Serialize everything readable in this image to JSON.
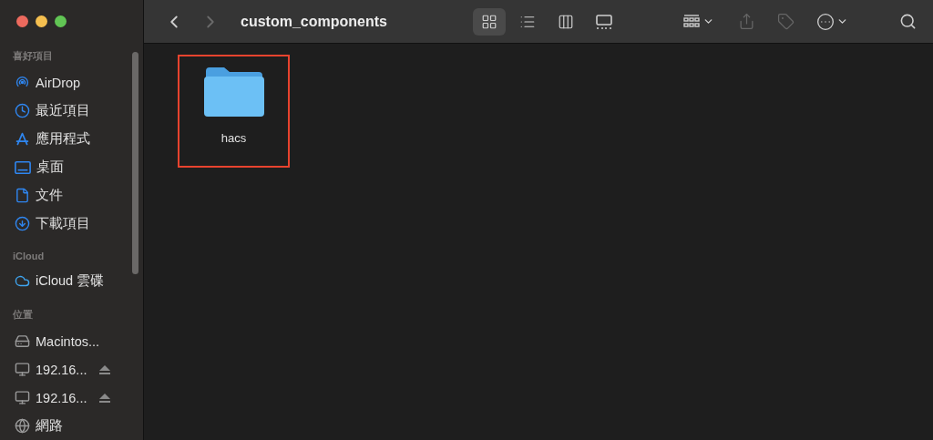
{
  "toolbar": {
    "title": "custom_components",
    "nav": [
      {
        "kind": "back",
        "disabled": false
      },
      {
        "kind": "forward",
        "disabled": true
      }
    ],
    "views": [
      {
        "kind": "icons",
        "selected": true
      },
      {
        "kind": "list",
        "selected": false
      },
      {
        "kind": "columns",
        "selected": false
      },
      {
        "kind": "gallery",
        "selected": false
      }
    ],
    "actions": [
      {
        "kind": "group",
        "disabled": false
      },
      {
        "kind": "share",
        "disabled": true
      },
      {
        "kind": "tag",
        "disabled": true
      },
      {
        "kind": "more",
        "disabled": false
      },
      {
        "kind": "search",
        "disabled": false
      }
    ]
  },
  "sidebar": {
    "sections": [
      {
        "heading": "喜好項目",
        "items": [
          {
            "label": "AirDrop",
            "kind": "airdrop",
            "eject": false
          },
          {
            "label": "最近項目",
            "kind": "recent",
            "eject": false
          },
          {
            "label": "應用程式",
            "kind": "apps",
            "eject": false
          },
          {
            "label": "桌面",
            "kind": "desktop",
            "eject": false
          },
          {
            "label": "文件",
            "kind": "document",
            "eject": false
          },
          {
            "label": "下載項目",
            "kind": "download",
            "eject": false
          }
        ]
      },
      {
        "heading": "iCloud",
        "items": [
          {
            "label": "iCloud 雲碟",
            "kind": "cloud",
            "eject": false
          }
        ]
      },
      {
        "heading": "位置",
        "items": [
          {
            "label": "Macintos...",
            "kind": "disk",
            "eject": false
          },
          {
            "label": "192.16...",
            "kind": "server",
            "eject": true
          },
          {
            "label": "192.16...",
            "kind": "server",
            "eject": true
          },
          {
            "label": "網路",
            "kind": "network",
            "eject": false
          }
        ]
      }
    ]
  },
  "files": [
    {
      "name": "hacs",
      "kind": "folder",
      "highlighted": true
    }
  ]
}
